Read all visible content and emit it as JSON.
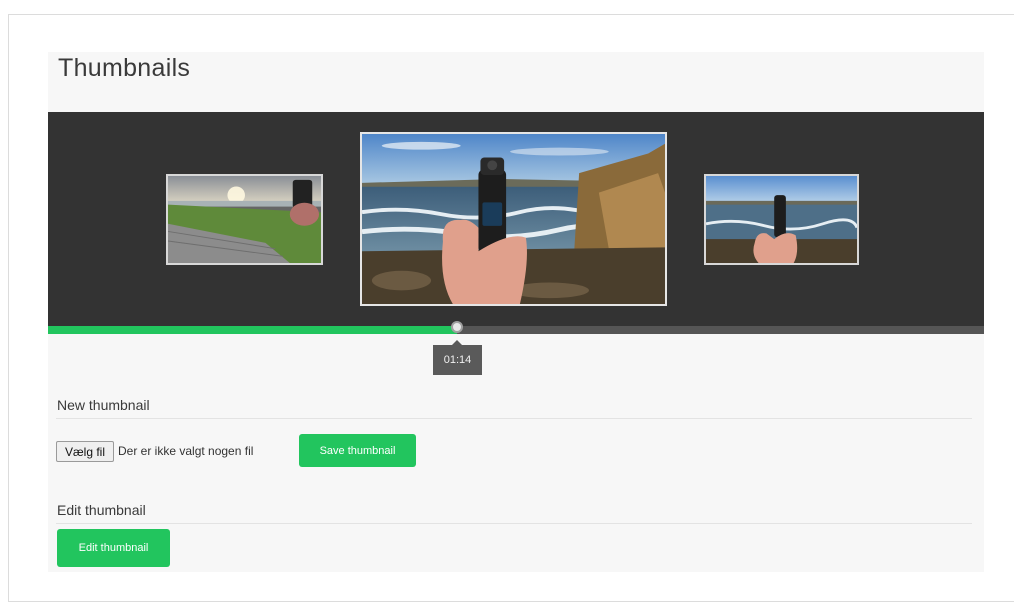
{
  "page": {
    "title": "Thumbnails"
  },
  "carousel": {
    "thumbnails": [
      {
        "name": "thumb-left",
        "description": "grass and wooden deck by sea at sunset"
      },
      {
        "name": "thumb-center",
        "description": "hand holding camera gimbal at rocky shore"
      },
      {
        "name": "thumb-right",
        "description": "hand holding camera gimbal at coast"
      }
    ]
  },
  "timeline": {
    "progress": 0.437,
    "time_label": "01:14",
    "fill_color": "#22c55e",
    "track_color": "#555555"
  },
  "new_thumbnail": {
    "heading": "New thumbnail",
    "file_button_label": "Vælg fil",
    "file_status": "Der er ikke valgt nogen fil",
    "save_label": "Save thumbnail"
  },
  "edit_thumbnail": {
    "heading": "Edit thumbnail",
    "edit_label": "Edit thumbnail"
  },
  "colors": {
    "accent": "#22c55e",
    "carousel_bg": "#333333"
  }
}
